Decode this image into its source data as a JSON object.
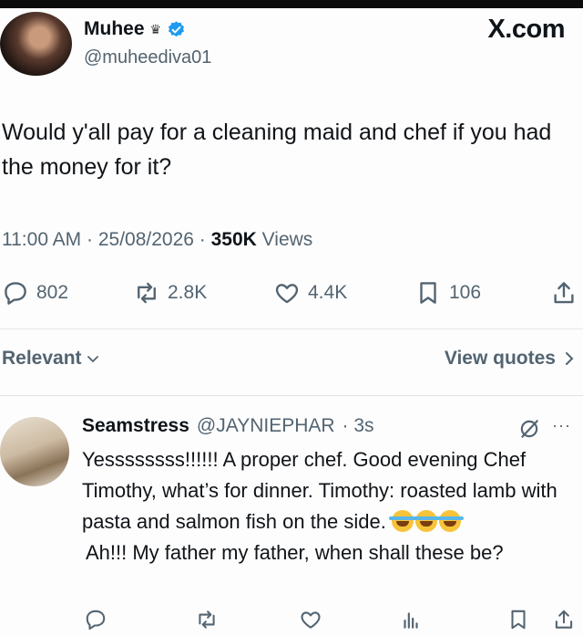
{
  "brand": "X.com",
  "author": {
    "name": "Muhee",
    "crown": "♛",
    "handle": "@muheediva01"
  },
  "tweet": {
    "text": "Would y'all pay for a cleaning maid and chef if you had the money for it?",
    "time": "11:00 AM",
    "sep1": " · ",
    "date": "25/08/2026",
    "sep2": " · ",
    "views_count": "350K",
    "views_label": " Views"
  },
  "actions": {
    "replies": "802",
    "reposts": "2.8K",
    "likes": "4.4K",
    "bookmarks": "106"
  },
  "filters": {
    "relevant": "Relevant",
    "view_quotes": "View quotes"
  },
  "reply": {
    "name": "Seamstress",
    "handle": "@JAYNIEPHAR",
    "time": "· 3s",
    "more": "···",
    "text_line1": "Yessssssss!!!!!! A proper chef. Good evening Chef Timothy, what’s for dinner. Timothy: roasted lamb with pasta and salmon fish on the side. ",
    "text_line2": "Ah!!! My father my father, when shall these be?"
  },
  "colors": {
    "verified": "#1d9bf0",
    "muted": "#536471",
    "text": "#0f1419"
  }
}
